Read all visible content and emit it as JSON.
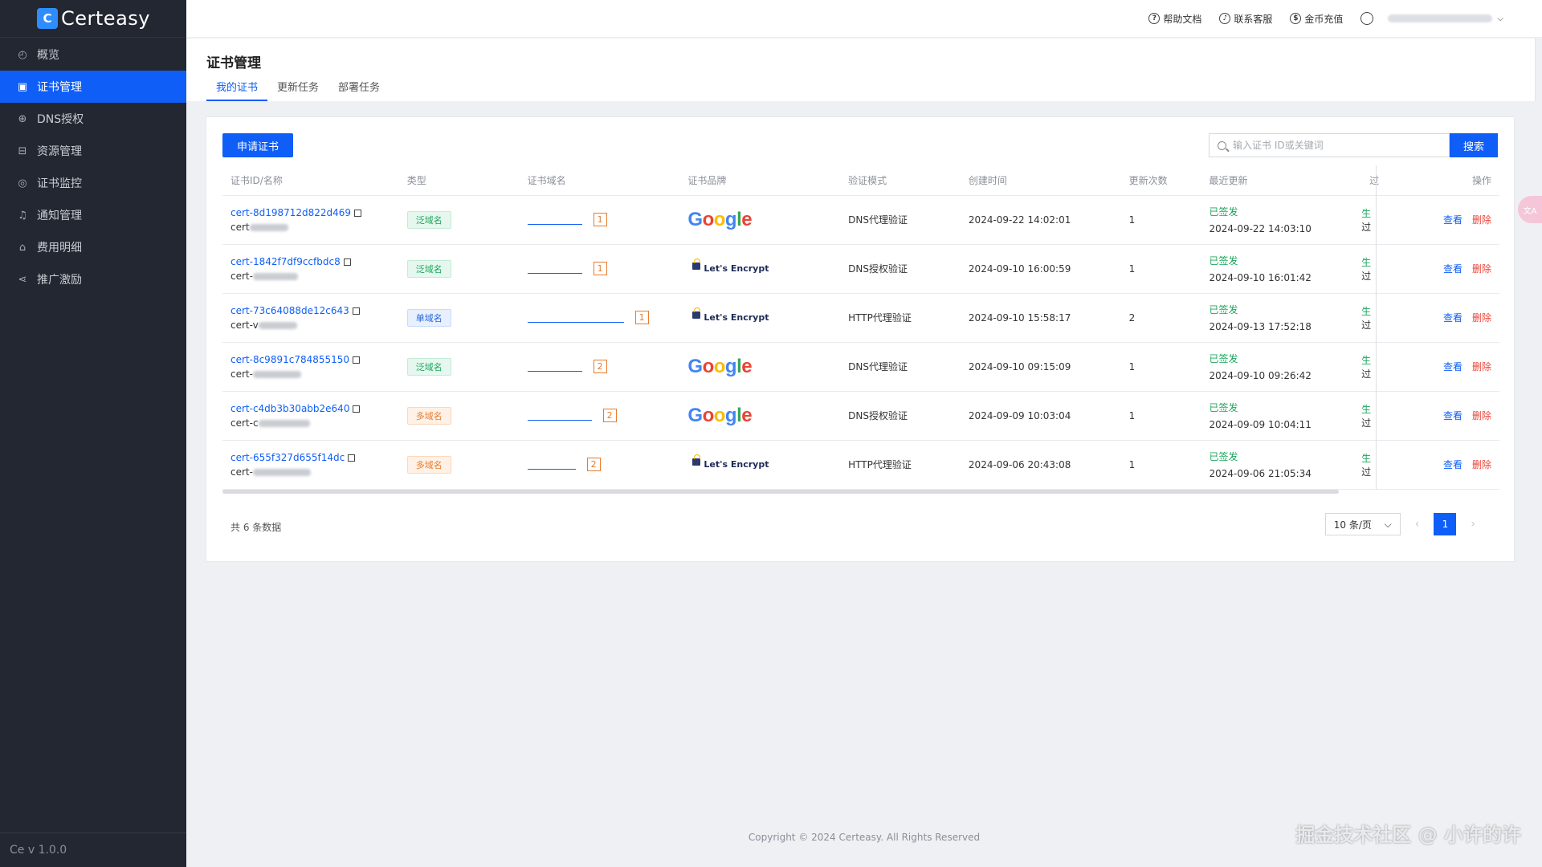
{
  "brand": {
    "logo_mark": "C",
    "name": "Certeasy"
  },
  "sidebar": {
    "items": [
      {
        "label": "概览",
        "icon": "gauge-icon",
        "glyph": "◴",
        "active": false
      },
      {
        "label": "证书管理",
        "icon": "certificate-icon",
        "glyph": "▣",
        "active": true
      },
      {
        "label": "DNS授权",
        "icon": "globe-icon",
        "glyph": "⊕",
        "active": false
      },
      {
        "label": "资源管理",
        "icon": "resource-icon",
        "glyph": "⊟",
        "active": false
      },
      {
        "label": "证书监控",
        "icon": "monitor-icon",
        "glyph": "◎",
        "active": false
      },
      {
        "label": "通知管理",
        "icon": "bell-icon",
        "glyph": "♫",
        "active": false
      },
      {
        "label": "费用明细",
        "icon": "wallet-icon",
        "glyph": "⌂",
        "active": false
      },
      {
        "label": "推广激励",
        "icon": "share-icon",
        "glyph": "⋖",
        "active": false
      }
    ],
    "version": "Ce v 1.0.0"
  },
  "header": {
    "help": "帮助文档",
    "support": "联系客服",
    "recharge": "金币充值"
  },
  "page": {
    "title": "证书管理",
    "tabs": [
      {
        "label": "我的证书",
        "active": true
      },
      {
        "label": "更新任务",
        "active": false
      },
      {
        "label": "部署任务",
        "active": false
      }
    ]
  },
  "toolbar": {
    "apply_label": "申请证书",
    "search_placeholder": "输入证书 ID或关键词",
    "search_label": "搜索"
  },
  "table": {
    "columns": [
      "证书ID/名称",
      "类型",
      "证书域名",
      "证书品牌",
      "验证模式",
      "创建时间",
      "更新次数",
      "最近更新",
      "过",
      "操作"
    ],
    "rows": [
      {
        "id": "cert-8d198712d822d469",
        "name_prefix": "cert",
        "type": "泛域名",
        "type_kind": "wild",
        "domain_count": "1",
        "brand": "Google",
        "verify": "DNS代理验证",
        "created": "2024-09-22 14:02:01",
        "updates": "1",
        "status": "已签发",
        "updated": "2024-09-22 14:03:10",
        "col_a": "生",
        "col_b": "过"
      },
      {
        "id": "cert-1842f7df9ccfbdc8",
        "name_prefix": "cert-",
        "type": "泛域名",
        "type_kind": "wild",
        "domain_count": "1",
        "brand": "Let's Encrypt",
        "verify": "DNS授权验证",
        "created": "2024-09-10 16:00:59",
        "updates": "1",
        "status": "已签发",
        "updated": "2024-09-10 16:01:42",
        "col_a": "生",
        "col_b": "过"
      },
      {
        "id": "cert-73c64088de12c643",
        "name_prefix": "cert-v",
        "type": "单域名",
        "type_kind": "single",
        "domain_count": "1",
        "brand": "Let's Encrypt",
        "verify": "HTTP代理验证",
        "created": "2024-09-10 15:58:17",
        "updates": "2",
        "status": "已签发",
        "updated": "2024-09-13 17:52:18",
        "col_a": "生",
        "col_b": "过"
      },
      {
        "id": "cert-8c9891c784855150",
        "name_prefix": "cert-",
        "type": "泛域名",
        "type_kind": "wild",
        "domain_count": "2",
        "brand": "Google",
        "verify": "DNS代理验证",
        "created": "2024-09-10 09:15:09",
        "updates": "1",
        "status": "已签发",
        "updated": "2024-09-10 09:26:42",
        "col_a": "生",
        "col_b": "过"
      },
      {
        "id": "cert-c4db3b30abb2e640",
        "name_prefix": "cert-c",
        "type": "多域名",
        "type_kind": "multi",
        "domain_count": "2",
        "brand": "Google",
        "verify": "DNS授权验证",
        "created": "2024-09-09 10:03:04",
        "updates": "1",
        "status": "已签发",
        "updated": "2024-09-09 10:04:11",
        "col_a": "生",
        "col_b": "过"
      },
      {
        "id": "cert-655f327d655f14dc",
        "name_prefix": "cert-",
        "type": "多域名",
        "type_kind": "multi",
        "domain_count": "2",
        "brand": "Let's Encrypt",
        "verify": "HTTP代理验证",
        "created": "2024-09-06 20:43:08",
        "updates": "1",
        "status": "已签发",
        "updated": "2024-09-06 21:05:34",
        "col_a": "生",
        "col_b": "过"
      }
    ],
    "view_label": "查看",
    "delete_label": "删除"
  },
  "pagination": {
    "total": "共 6 条数据",
    "page_size": "10 条/页",
    "current_page": "1"
  },
  "float_tab_label": "文A",
  "footer": "Copyright © 2024 Certeasy. All Rights Reserved",
  "watermark": "掘金技术社区 @ 小许的许",
  "colors": {
    "primary": "#0f5ef7",
    "sidebar": "#232731",
    "success": "#1ca55d",
    "danger": "#e8453a",
    "warning": "#e67c2e"
  }
}
